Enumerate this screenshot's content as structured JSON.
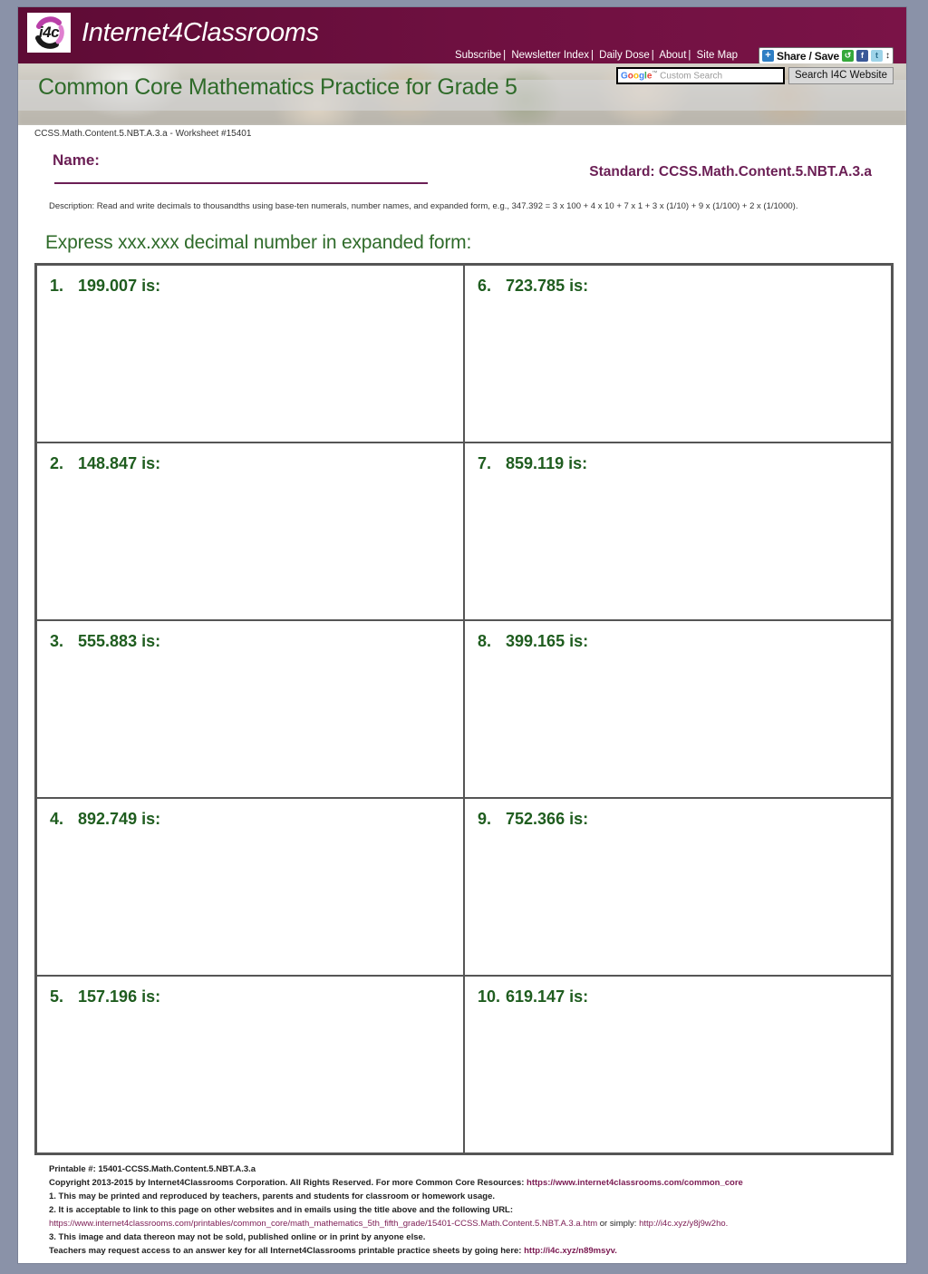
{
  "site": {
    "logo_badge_text": "i4c",
    "logo_wordmark": "Internet4Classrooms"
  },
  "topnav": {
    "items": [
      {
        "label": "Subscribe"
      },
      {
        "label": "Newsletter Index"
      },
      {
        "label": "Daily Dose"
      },
      {
        "label": "About"
      },
      {
        "label": "Site Map"
      }
    ],
    "separator": "|"
  },
  "share_widget": {
    "plus_icon": "plus-icon",
    "label": "Share / Save",
    "icons": [
      "sharethis-icon",
      "facebook-icon",
      "twitter-icon"
    ],
    "arrows": "↕"
  },
  "search": {
    "brand_g": "G",
    "brand_o1": "o",
    "brand_o2": "o",
    "brand_g2": "g",
    "brand_l": "l",
    "brand_e": "e",
    "trademark": "™",
    "placeholder": "Custom Search",
    "button_label": "Search I4C Website"
  },
  "banner": {
    "title": "Common Core Mathematics Practice for Grade 5"
  },
  "worksheet": {
    "id_line": "CCSS.Math.Content.5.NBT.A.3.a - Worksheet #15401",
    "name_label": "Name:",
    "standard": "Standard: CCSS.Math.Content.5.NBT.A.3.a",
    "description": "Description: Read and write decimals to thousandths using base-ten numerals, number names, and expanded form, e.g., 347.392 = 3 x 100 + 4 x 10 + 7 x 1 + 3 x (1/10) + 9 x (1/100) + 2 x (1/1000).",
    "instruction": "Express xxx.xxx decimal number in expanded form:"
  },
  "problems": [
    {
      "number": "1.",
      "text": "199.007 is:"
    },
    {
      "number": "6.",
      "text": "723.785 is:"
    },
    {
      "number": "2.",
      "text": "148.847 is:"
    },
    {
      "number": "7.",
      "text": "859.119 is:"
    },
    {
      "number": "3.",
      "text": "555.883 is:"
    },
    {
      "number": "8.",
      "text": "399.165 is:"
    },
    {
      "number": "4.",
      "text": "892.749 is:"
    },
    {
      "number": "9.",
      "text": "752.366 is:"
    },
    {
      "number": "5.",
      "text": "157.196 is:"
    },
    {
      "number": "10.",
      "text": "619.147 is:"
    }
  ],
  "footer": {
    "printable": "Printable #: 15401-CCSS.Math.Content.5.NBT.A.3.a",
    "copyright_pre": "Copyright 2013-2015 by Internet4Classrooms Corporation. All Rights Reserved. For more Common Core Resources: ",
    "copyright_link": "https://www.internet4classrooms.com/common_core",
    "line1": "1. This may be printed and reproduced by teachers, parents and students for classroom or homework usage.",
    "line2": "2. It is acceptable to link to this page on other websites and in emails using the title above and the following URL:",
    "url_long": "https://www.internet4classrooms.com/printables/common_core/math_mathematics_5th_fifth_grade/15401-CCSS.Math.Content.5.NBT.A.3.a.htm",
    "url_mid": " or simply: ",
    "url_short": "http://i4c.xyz/y8j9w2ho.",
    "line3": "3. This image and data thereon may not be sold, published online or in print by anyone else.",
    "answer_key_pre": "Teachers may request access to an answer key for all Internet4Classrooms printable practice sheets by going here: ",
    "answer_key_link": "http://i4c.xyz/n89msyv."
  },
  "colors": {
    "maroon": "#6b0f3d",
    "heading_green": "#2f6b2a",
    "problem_green": "#1f5d1f",
    "standard_purple": "#6b1f55",
    "page_background": "#8a92a8"
  }
}
